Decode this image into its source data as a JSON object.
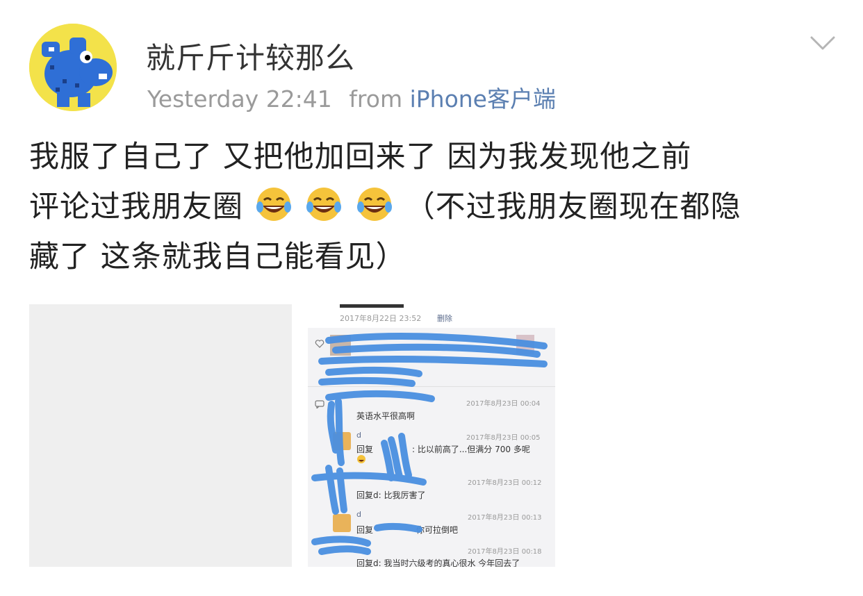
{
  "post": {
    "username": "就斤斤计较那么",
    "time": "Yesterday 22:41",
    "from_label": "from",
    "source": "iPhone客户端",
    "text_line1": "我服了自己了 又把他加回来了 因为我发现他之前",
    "text_line2a": "评论过我朋友圈",
    "text_line2b": " （不过我朋友圈现在都隐",
    "text_line3": "藏了 这条就我自己能看见）",
    "emoji_count": 3
  },
  "screenshot": {
    "header_date": "2017年8月22日 23:52",
    "delete_label": "删除",
    "comments": [
      {
        "time": "2017年8月23日 00:04",
        "text": "英语水平很高啊"
      },
      {
        "name": "d",
        "time": "2017年8月23日 00:05",
        "text_prefix": "回复",
        "text": ": 比以前高了...但满分 700 多呢"
      },
      {
        "time": "2017年8月23日 00:12",
        "text": "回复d: 比我厉害了"
      },
      {
        "name": "d",
        "time": "2017年8月23日 00:13",
        "text_prefix": "回复",
        "text": "你可拉倒吧"
      },
      {
        "time": "2017年8月23日 00:18",
        "text": "回复d: 我当时六级考的真心很水 今年回去了"
      }
    ]
  },
  "colors": {
    "accent": "#5b7fb1",
    "meta_gray": "#9a9a9a",
    "scribble": "#4a8fe0",
    "avatar_bg": "#f3e24a"
  }
}
